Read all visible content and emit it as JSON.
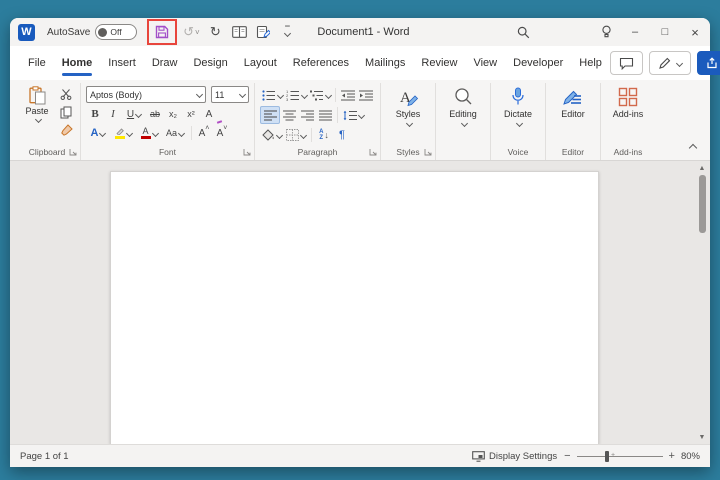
{
  "window": {
    "title": "Document1  -  Word"
  },
  "titlebar": {
    "autosave_label": "AutoSave",
    "autosave_state": "Off"
  },
  "icons": {
    "undo": "↺",
    "redo": "↻",
    "minimize": "–",
    "maximize": "□",
    "close": "×",
    "scroll_up": "▲",
    "scroll_down": "▼",
    "zoom_out": "−",
    "zoom_in": "+"
  },
  "menubar": {
    "tabs": [
      "File",
      "Home",
      "Insert",
      "Draw",
      "Design",
      "Layout",
      "References",
      "Mailings",
      "Review",
      "View",
      "Developer",
      "Help"
    ],
    "active_tab": "Home"
  },
  "ribbon": {
    "clipboard": {
      "paste_label": "Paste",
      "group_label": "Clipboard"
    },
    "font": {
      "font_name": "Aptos (Body)",
      "font_size": "11",
      "bold": "B",
      "italic": "I",
      "underline": "U",
      "strikethrough": "ab",
      "subscript": "x₂",
      "superscript": "x²",
      "clear_formatting": "A",
      "text_effects": "A",
      "font_color": "A",
      "change_case": "Aa",
      "grow_font": "A",
      "shrink_font": "A",
      "group_label": "Font"
    },
    "paragraph": {
      "sort_a": "A",
      "sort_z": "Z",
      "pilcrow": "¶",
      "group_label": "Paragraph"
    },
    "styles": {
      "button_label": "Styles",
      "group_label": "Styles"
    },
    "editing": {
      "button_label": "Editing"
    },
    "voice": {
      "button_label": "Dictate",
      "group_label": "Voice"
    },
    "editor": {
      "button_label": "Editor",
      "group_label": "Editor"
    },
    "addins": {
      "button_label": "Add-ins",
      "group_label": "Add-ins"
    }
  },
  "statusbar": {
    "page_indicator": "Page 1 of 1",
    "display_settings_label": "Display Settings",
    "zoom_level": "80%"
  },
  "colors": {
    "desktop_background": "#2c7d9d",
    "accent_blue": "#2563c4",
    "share_button_blue": "#1b5bbd",
    "save_icon_purple": "#a24fc8",
    "highlight_box_red": "#e8453c",
    "dictate_mic_blue": "#3f7fd4",
    "addins_orange": "#d2694b",
    "font_color_red": "#c00000",
    "highlight_yellow": "#ffe800"
  }
}
